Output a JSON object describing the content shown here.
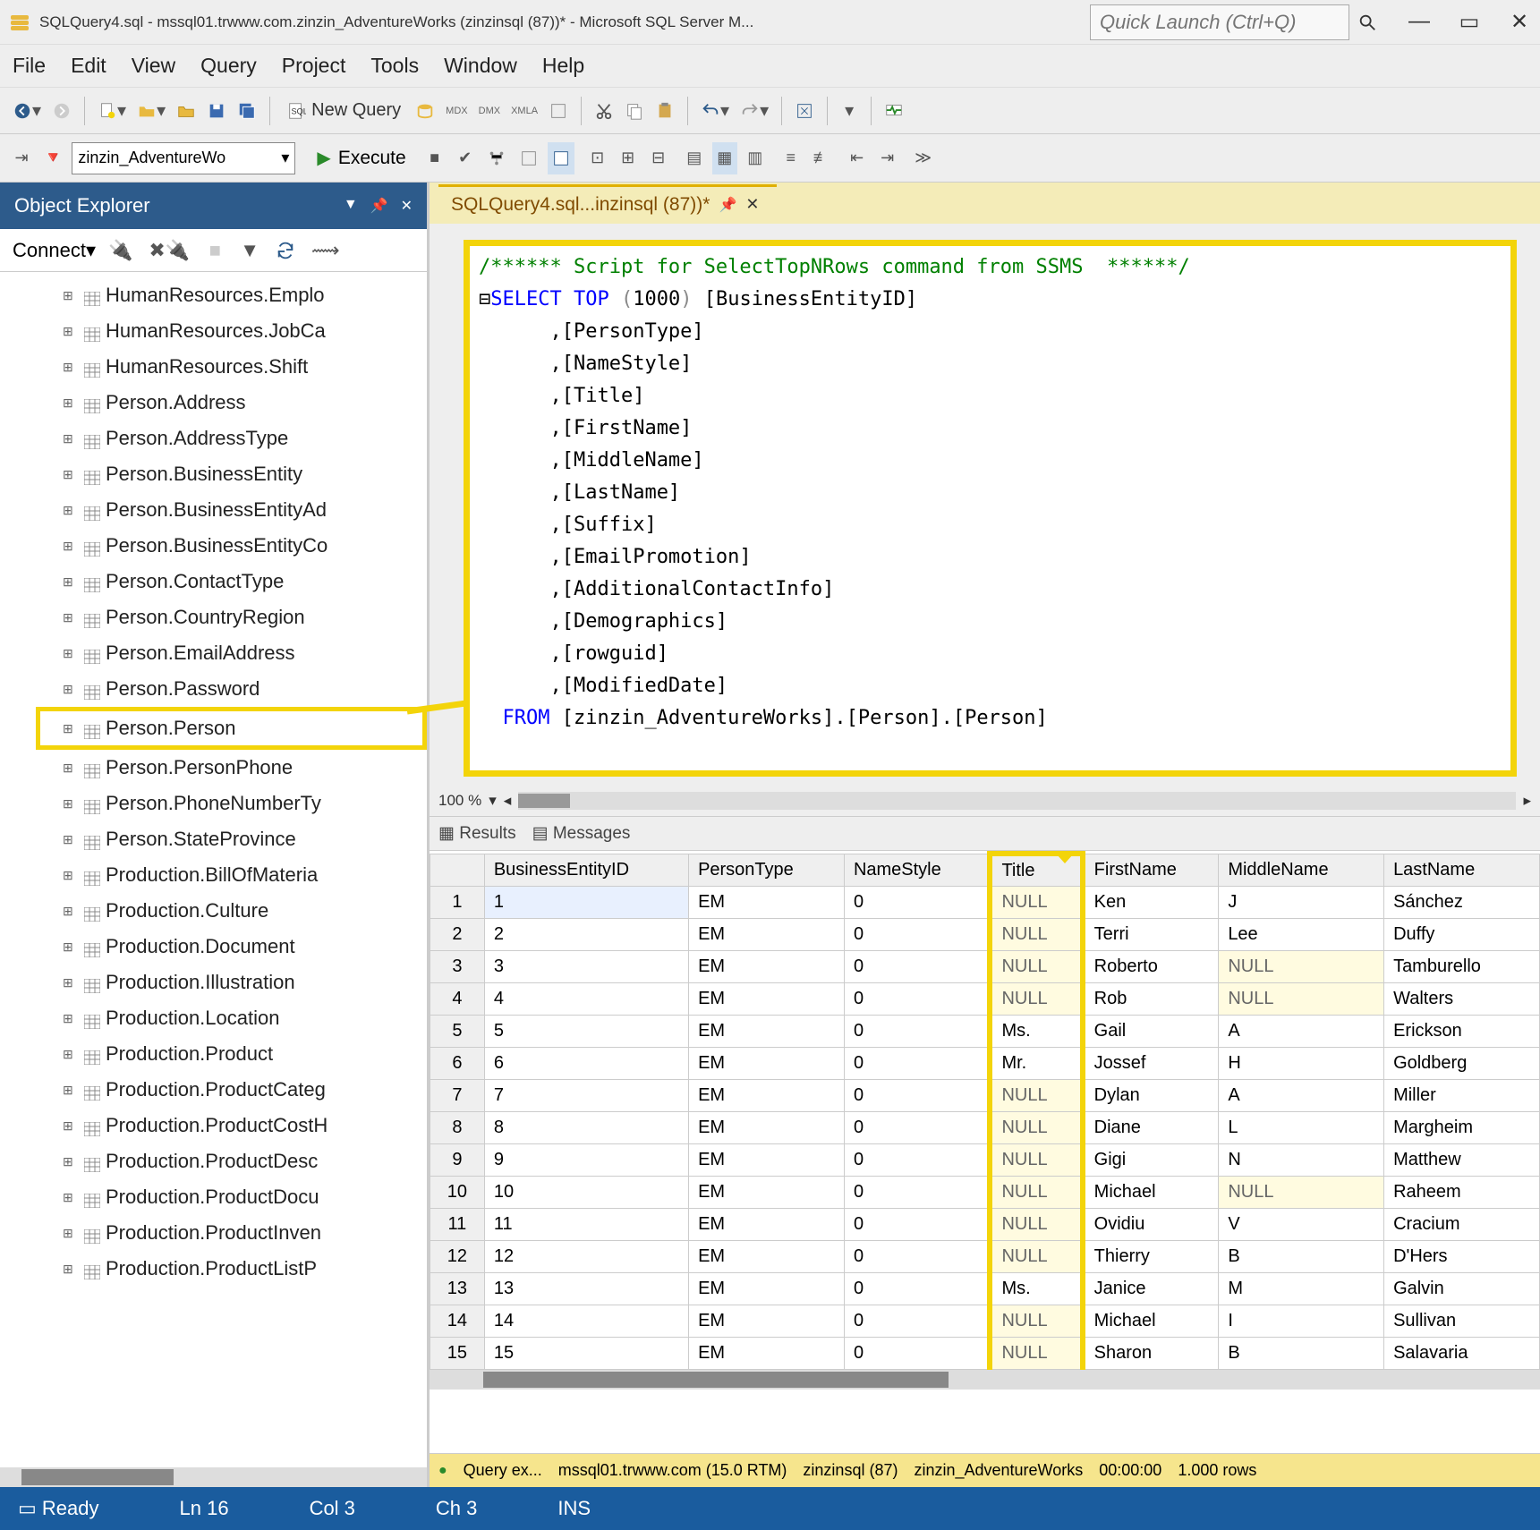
{
  "window": {
    "title": "SQLQuery4.sql - mssql01.trwww.com.zinzin_AdventureWorks (zinzinsql (87))* - Microsoft SQL Server M...",
    "quick_launch_placeholder": "Quick Launch (Ctrl+Q)"
  },
  "menu": [
    "File",
    "Edit",
    "View",
    "Query",
    "Project",
    "Tools",
    "Window",
    "Help"
  ],
  "toolbar": {
    "new_query": "New Query",
    "execute": "Execute",
    "database": "zinzin_AdventureWo"
  },
  "object_explorer": {
    "title": "Object Explorer",
    "connect": "Connect",
    "items": [
      "HumanResources.Emplo",
      "HumanResources.JobCa",
      "HumanResources.Shift",
      "Person.Address",
      "Person.AddressType",
      "Person.BusinessEntity",
      "Person.BusinessEntityAd",
      "Person.BusinessEntityCo",
      "Person.ContactType",
      "Person.CountryRegion",
      "Person.EmailAddress",
      "Person.Password",
      "Person.Person",
      "Person.PersonPhone",
      "Person.PhoneNumberTy",
      "Person.StateProvince",
      "Production.BillOfMateria",
      "Production.Culture",
      "Production.Document",
      "Production.Illustration",
      "Production.Location",
      "Production.Product",
      "Production.ProductCateg",
      "Production.ProductCostH",
      "Production.ProductDesc",
      "Production.ProductDocu",
      "Production.ProductInven",
      "Production.ProductListP"
    ],
    "highlighted_index": 12
  },
  "tab": {
    "label": "SQLQuery4.sql...inzinsql (87))*"
  },
  "sql": {
    "comment": "/****** Script for SelectTopNRows command from SSMS  ******/",
    "select": "SELECT",
    "top": "TOP",
    "num": "(1000)",
    "cols": [
      "[BusinessEntityID]",
      ",[PersonType]",
      ",[NameStyle]",
      ",[Title]",
      ",[FirstName]",
      ",[MiddleName]",
      ",[LastName]",
      ",[Suffix]",
      ",[EmailPromotion]",
      ",[AdditionalContactInfo]",
      ",[Demographics]",
      ",[rowguid]",
      ",[ModifiedDate]"
    ],
    "from": "FROM",
    "table": "[zinzin_AdventureWorks].[Person].[Person]"
  },
  "zoom": "100 %",
  "results_tabs": {
    "results": "Results",
    "messages": "Messages"
  },
  "grid": {
    "columns": [
      "BusinessEntityID",
      "PersonType",
      "NameStyle",
      "Title",
      "FirstName",
      "MiddleName",
      "LastName"
    ],
    "highlight_col": 3,
    "rows": [
      {
        "n": 1,
        "c": [
          "1",
          "EM",
          "0",
          "NULL",
          "Ken",
          "J",
          "Sánchez"
        ]
      },
      {
        "n": 2,
        "c": [
          "2",
          "EM",
          "0",
          "NULL",
          "Terri",
          "Lee",
          "Duffy"
        ]
      },
      {
        "n": 3,
        "c": [
          "3",
          "EM",
          "0",
          "NULL",
          "Roberto",
          "NULL",
          "Tamburello"
        ]
      },
      {
        "n": 4,
        "c": [
          "4",
          "EM",
          "0",
          "NULL",
          "Rob",
          "NULL",
          "Walters"
        ]
      },
      {
        "n": 5,
        "c": [
          "5",
          "EM",
          "0",
          "Ms.",
          "Gail",
          "A",
          "Erickson"
        ]
      },
      {
        "n": 6,
        "c": [
          "6",
          "EM",
          "0",
          "Mr.",
          "Jossef",
          "H",
          "Goldberg"
        ]
      },
      {
        "n": 7,
        "c": [
          "7",
          "EM",
          "0",
          "NULL",
          "Dylan",
          "A",
          "Miller"
        ]
      },
      {
        "n": 8,
        "c": [
          "8",
          "EM",
          "0",
          "NULL",
          "Diane",
          "L",
          "Margheim"
        ]
      },
      {
        "n": 9,
        "c": [
          "9",
          "EM",
          "0",
          "NULL",
          "Gigi",
          "N",
          "Matthew"
        ]
      },
      {
        "n": 10,
        "c": [
          "10",
          "EM",
          "0",
          "NULL",
          "Michael",
          "NULL",
          "Raheem"
        ]
      },
      {
        "n": 11,
        "c": [
          "11",
          "EM",
          "0",
          "NULL",
          "Ovidiu",
          "V",
          "Cracium"
        ]
      },
      {
        "n": 12,
        "c": [
          "12",
          "EM",
          "0",
          "NULL",
          "Thierry",
          "B",
          "D'Hers"
        ]
      },
      {
        "n": 13,
        "c": [
          "13",
          "EM",
          "0",
          "Ms.",
          "Janice",
          "M",
          "Galvin"
        ]
      },
      {
        "n": 14,
        "c": [
          "14",
          "EM",
          "0",
          "NULL",
          "Michael",
          "I",
          "Sullivan"
        ]
      },
      {
        "n": 15,
        "c": [
          "15",
          "EM",
          "0",
          "NULL",
          "Sharon",
          "B",
          "Salavaria"
        ]
      }
    ]
  },
  "status": {
    "query": "Query ex...",
    "server": "mssql01.trwww.com (15.0 RTM)",
    "user": "zinzinsql (87)",
    "db": "zinzin_AdventureWorks",
    "time": "00:00:00",
    "rows": "1.000 rows"
  },
  "bottom": {
    "ready": "Ready",
    "ln": "Ln 16",
    "col": "Col 3",
    "ch": "Ch 3",
    "ins": "INS"
  }
}
